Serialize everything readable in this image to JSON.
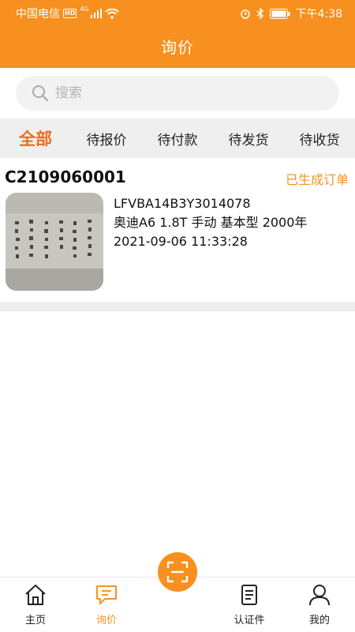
{
  "status_bar": {
    "carrier": "中国电信",
    "hd": "HD",
    "network": "4G",
    "time": "下午4:38"
  },
  "header": {
    "title": "询价"
  },
  "search": {
    "placeholder": "搜索",
    "value": ""
  },
  "tabs": [
    {
      "label": "全部",
      "active": true
    },
    {
      "label": "待报价",
      "active": false
    },
    {
      "label": "待付款",
      "active": false
    },
    {
      "label": "待发货",
      "active": false
    },
    {
      "label": "待收货",
      "active": false
    }
  ],
  "orders": [
    {
      "order_no": "C2109060001",
      "status": "已生成订单",
      "vin": "LFVBA14B3Y3014078",
      "vehicle": "奥迪A6 1.8T 手动 基本型 2000年",
      "datetime": "2021-09-06 11:33:28"
    }
  ],
  "bottom_nav": [
    {
      "label": "主页",
      "icon": "home-icon",
      "active": false
    },
    {
      "label": "询价",
      "icon": "message-icon",
      "active": true
    },
    {
      "label": "认证件",
      "icon": "document-icon",
      "active": false
    },
    {
      "label": "我的",
      "icon": "user-icon",
      "active": false
    }
  ],
  "colors": {
    "accent": "#f7901e",
    "active_tab": "#f06b1e",
    "status_text": "#f39423"
  }
}
